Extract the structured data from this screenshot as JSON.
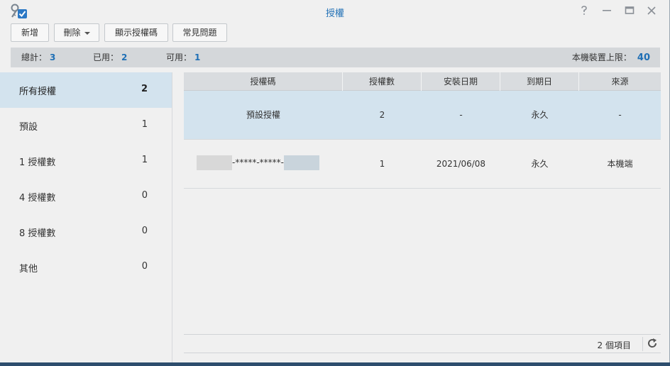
{
  "window": {
    "title": "授權"
  },
  "toolbar": {
    "add_label": "新增",
    "delete_label": "刪除",
    "show_key_label": "顯示授權碼",
    "faq_label": "常見問題"
  },
  "stats": {
    "total_label": "總計：",
    "total_value": "3",
    "used_label": "已用：",
    "used_value": "2",
    "available_label": "可用：",
    "available_value": "1",
    "limit_label": "本機裝置上限：",
    "limit_value": "40"
  },
  "sidebar": {
    "items": [
      {
        "label": "所有授權",
        "count": "2"
      },
      {
        "label": "預設",
        "count": "1"
      },
      {
        "label": "1 授權數",
        "count": "1"
      },
      {
        "label": "4 授權數",
        "count": "0"
      },
      {
        "label": "8 授權數",
        "count": "0"
      },
      {
        "label": "其他",
        "count": "0"
      }
    ]
  },
  "table": {
    "columns": [
      "授權碼",
      "授權數",
      "安裝日期",
      "到期日",
      "來源"
    ],
    "rows": [
      {
        "key": "預設授權",
        "count": "2",
        "install_date": "-",
        "expiry": "永久",
        "source": "-"
      },
      {
        "key": "-*****-*****-",
        "count": "1",
        "install_date": "2021/06/08",
        "expiry": "永久",
        "source": "本機端"
      }
    ]
  },
  "footer": {
    "item_count": "2 個項目"
  },
  "colors": {
    "accent": "#1f6fb5",
    "selected_row": "#d3e3ee",
    "header_bg": "#d9dcdf"
  }
}
